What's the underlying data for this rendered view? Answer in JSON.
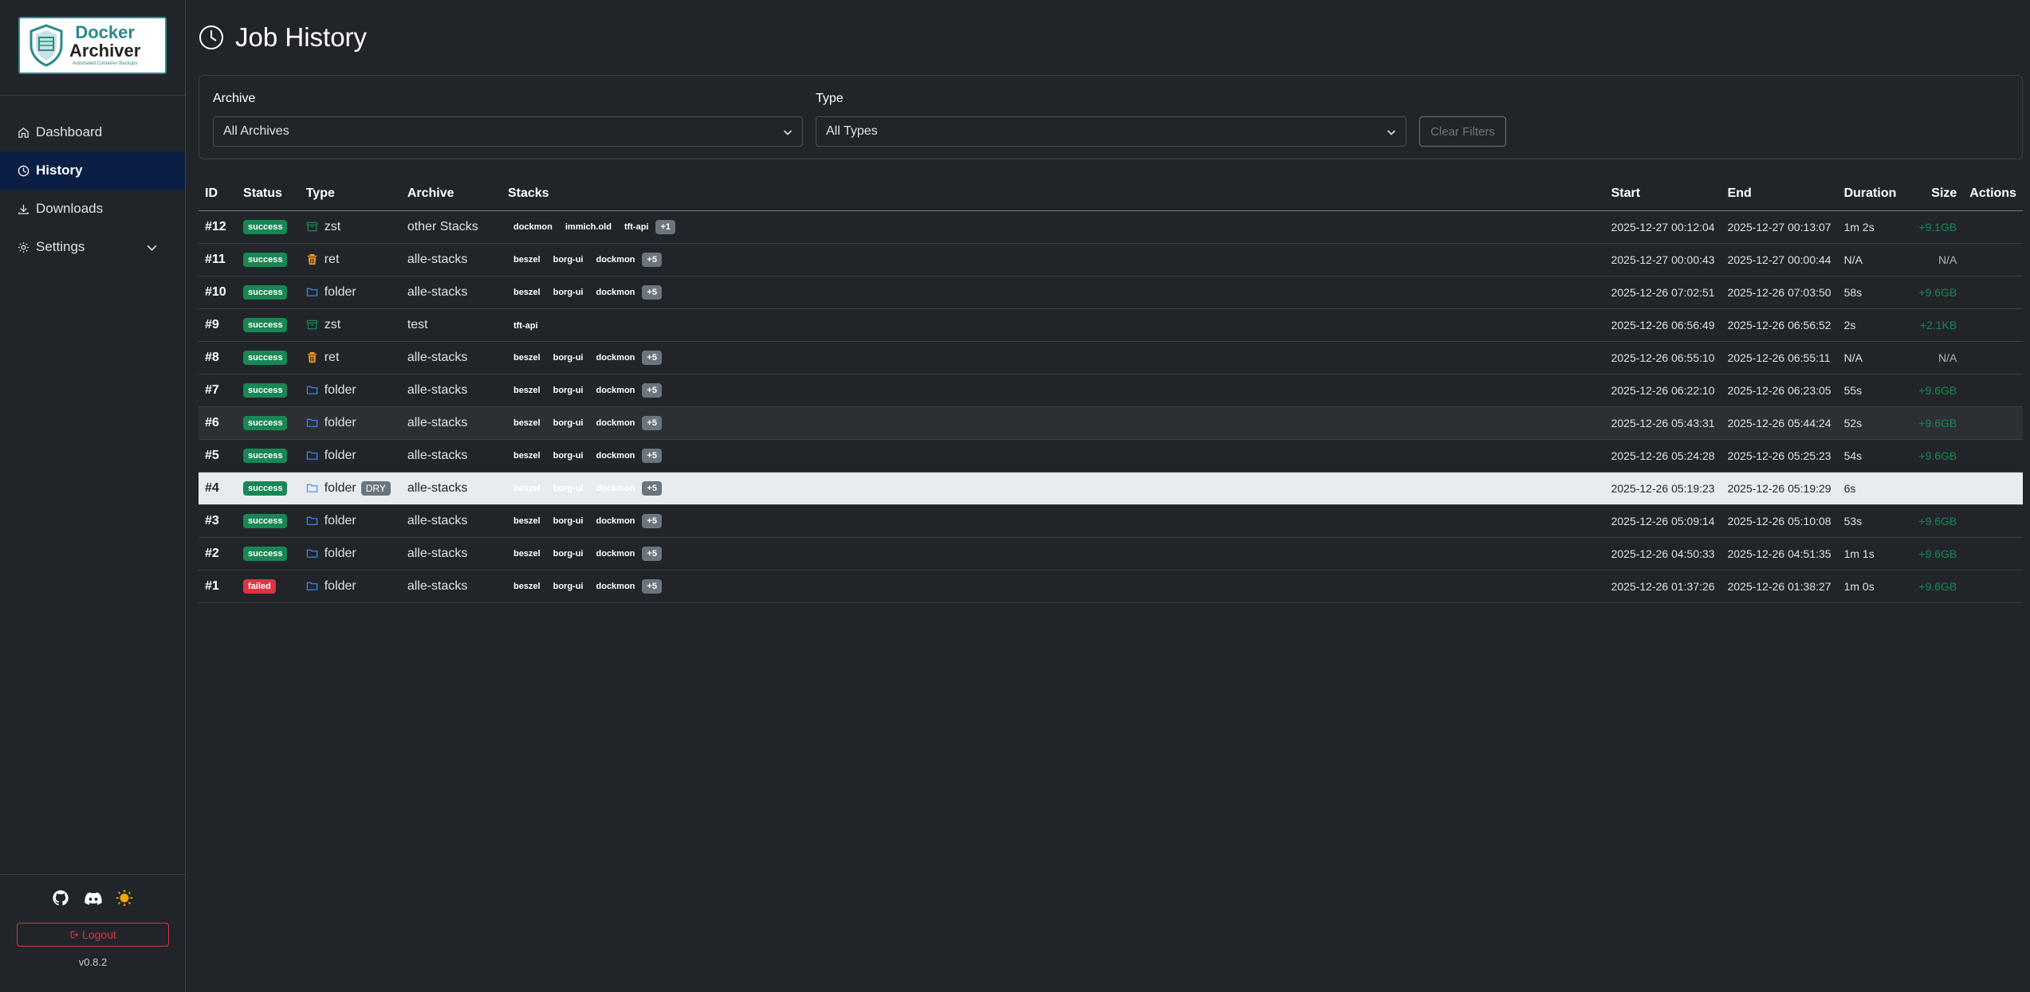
{
  "brand": {
    "line1": "Docker",
    "line2": "Archiver",
    "tagline": "Automated Container Backups"
  },
  "nav": {
    "dashboard": "Dashboard",
    "history": "History",
    "downloads": "Downloads",
    "settings": "Settings"
  },
  "footer": {
    "logout": "Logout",
    "version": "v0.8.2"
  },
  "page": {
    "title": "Job History"
  },
  "filters": {
    "archive_label": "Archive",
    "archive_value": "All Archives",
    "type_label": "Type",
    "type_value": "All Types",
    "clear": "Clear Filters"
  },
  "table": {
    "headers": {
      "id": "ID",
      "status": "Status",
      "type": "Type",
      "archive": "Archive",
      "stacks": "Stacks",
      "start": "Start",
      "end": "End",
      "duration": "Duration",
      "size": "Size",
      "actions": "Actions"
    },
    "rows": [
      {
        "id": "#12",
        "status": "success",
        "type": "zst",
        "archive": "other Stacks",
        "stacks": [
          "dockmon",
          "immich.old",
          "tft-api"
        ],
        "more": "+1",
        "start": "2025-12-27 00:12:04",
        "end": "2025-12-27 00:13:07",
        "duration": "1m 2s",
        "size": "+9.1GB"
      },
      {
        "id": "#11",
        "status": "success",
        "type": "ret",
        "archive": "alle-stacks",
        "stacks": [
          "beszel",
          "borg-ui",
          "dockmon"
        ],
        "more": "+5",
        "start": "2025-12-27 00:00:43",
        "end": "2025-12-27 00:00:44",
        "duration": "N/A",
        "size": "N/A"
      },
      {
        "id": "#10",
        "status": "success",
        "type": "folder",
        "archive": "alle-stacks",
        "stacks": [
          "beszel",
          "borg-ui",
          "dockmon"
        ],
        "more": "+5",
        "start": "2025-12-26 07:02:51",
        "end": "2025-12-26 07:03:50",
        "duration": "58s",
        "size": "+9.6GB"
      },
      {
        "id": "#9",
        "status": "success",
        "type": "zst",
        "archive": "test",
        "stacks": [
          "tft-api"
        ],
        "more": "",
        "start": "2025-12-26 06:56:49",
        "end": "2025-12-26 06:56:52",
        "duration": "2s",
        "size": "+2.1KB"
      },
      {
        "id": "#8",
        "status": "success",
        "type": "ret",
        "archive": "alle-stacks",
        "stacks": [
          "beszel",
          "borg-ui",
          "dockmon"
        ],
        "more": "+5",
        "start": "2025-12-26 06:55:10",
        "end": "2025-12-26 06:55:11",
        "duration": "N/A",
        "size": "N/A"
      },
      {
        "id": "#7",
        "status": "success",
        "type": "folder",
        "archive": "alle-stacks",
        "stacks": [
          "beszel",
          "borg-ui",
          "dockmon"
        ],
        "more": "+5",
        "start": "2025-12-26 06:22:10",
        "end": "2025-12-26 06:23:05",
        "duration": "55s",
        "size": "+9.6GB"
      },
      {
        "id": "#6",
        "status": "success",
        "type": "folder",
        "archive": "alle-stacks",
        "stacks": [
          "beszel",
          "borg-ui",
          "dockmon"
        ],
        "more": "+5",
        "start": "2025-12-26 05:43:31",
        "end": "2025-12-26 05:44:24",
        "duration": "52s",
        "size": "+9.6GB"
      },
      {
        "id": "#5",
        "status": "success",
        "type": "folder",
        "archive": "alle-stacks",
        "stacks": [
          "beszel",
          "borg-ui",
          "dockmon"
        ],
        "more": "+5",
        "start": "2025-12-26 05:24:28",
        "end": "2025-12-26 05:25:23",
        "duration": "54s",
        "size": "+9.6GB"
      },
      {
        "id": "#4",
        "status": "success",
        "type": "folder",
        "dry": "DRY",
        "archive": "alle-stacks",
        "stacks": [
          "beszel",
          "borg-ui",
          "dockmon"
        ],
        "more": "+5",
        "start": "2025-12-26 05:19:23",
        "end": "2025-12-26 05:19:29",
        "duration": "6s",
        "size": ""
      },
      {
        "id": "#3",
        "status": "success",
        "type": "folder",
        "archive": "alle-stacks",
        "stacks": [
          "beszel",
          "borg-ui",
          "dockmon"
        ],
        "more": "+5",
        "start": "2025-12-26 05:09:14",
        "end": "2025-12-26 05:10:08",
        "duration": "53s",
        "size": "+9.6GB"
      },
      {
        "id": "#2",
        "status": "success",
        "type": "folder",
        "archive": "alle-stacks",
        "stacks": [
          "beszel",
          "borg-ui",
          "dockmon"
        ],
        "more": "+5",
        "start": "2025-12-26 04:50:33",
        "end": "2025-12-26 04:51:35",
        "duration": "1m 1s",
        "size": "+9.6GB"
      },
      {
        "id": "#1",
        "status": "failed",
        "type": "folder",
        "archive": "alle-stacks",
        "stacks": [
          "beszel",
          "borg-ui",
          "dockmon"
        ],
        "more": "+5",
        "start": "2025-12-26 01:37:26",
        "end": "2025-12-26 01:38:27",
        "duration": "1m 0s",
        "size": "+9.6GB"
      }
    ]
  },
  "colors": {
    "success": "#198754",
    "failed": "#dc3545",
    "folder": "#3d8bfd",
    "zst": "#198754",
    "ret": "#fd9a1c",
    "active_nav": "#0b1f44"
  }
}
